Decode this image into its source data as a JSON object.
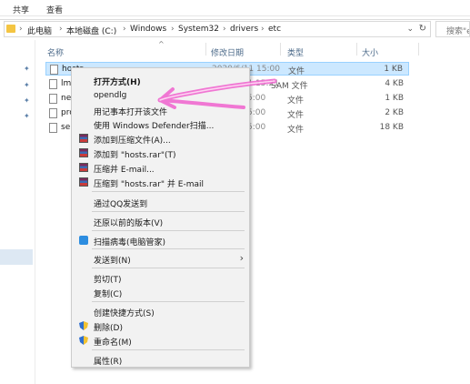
{
  "ribbon": {
    "tabs": [
      "共享",
      "查看"
    ]
  },
  "address": {
    "crumbs": [
      "此电脑",
      "本地磁盘 (C:)",
      "Windows",
      "System32",
      "drivers",
      "etc"
    ],
    "search_placeholder": "搜索\"e"
  },
  "columns": {
    "name": "名称",
    "date": "修改日期",
    "type": "类型",
    "size": "大小"
  },
  "files": [
    {
      "name": "hosts",
      "date": "2020/6/11 15:00",
      "type": "文件",
      "size": "1 KB",
      "selected": true
    },
    {
      "name": "lmh",
      "date": "2020/6/11 15:21",
      "type": "SAM 文件",
      "size": "4 KB"
    },
    {
      "name": "net",
      "date": "5:00",
      "type": "文件",
      "size": "1 KB"
    },
    {
      "name": "pro",
      "date": "5:00",
      "type": "文件",
      "size": "2 KB"
    },
    {
      "name": "ser",
      "date": "5:00",
      "type": "文件",
      "size": "18 KB"
    }
  ],
  "menu": {
    "open_with": "打开方式(H)",
    "opendlg": "opendlg",
    "open_notepad": "用记事本打开该文件",
    "defender": "使用 Windows Defender扫描...",
    "add_archive": "添加到压缩文件(A)...",
    "add_rar": "添加到 \"hosts.rar\"(T)",
    "compress_email": "压缩并 E-mail...",
    "compress_rar_email": "压缩到 \"hosts.rar\" 并 E-mail",
    "qq_send": "通过QQ发送到",
    "restore": "还原以前的版本(V)",
    "scan_virus": "扫描病毒(电脑管家)",
    "send_to": "发送到(N)",
    "cut": "剪切(T)",
    "copy": "复制(C)",
    "shortcut": "创建快捷方式(S)",
    "delete": "删除(D)",
    "rename": "重命名(M)",
    "properties": "属性(R)"
  },
  "colors": {
    "accent": "#cce8ff",
    "annotation": "#f06ad0"
  }
}
